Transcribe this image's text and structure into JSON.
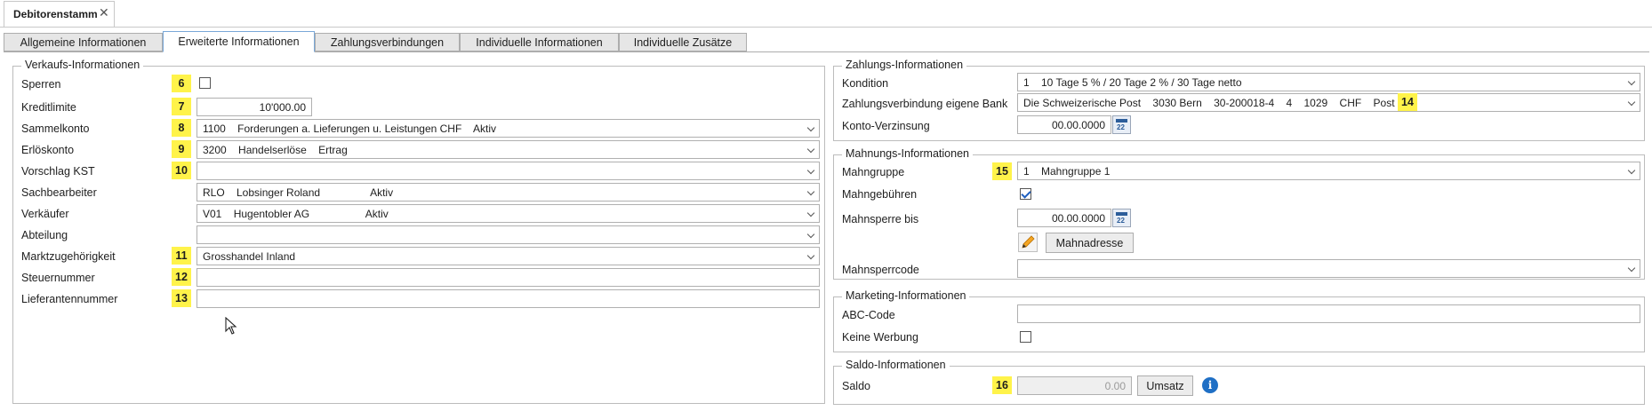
{
  "window": {
    "tab_title": "Debitorenstamm",
    "close_glyph": "✕"
  },
  "tabs": [
    {
      "label": "Allgemeine Informationen"
    },
    {
      "label": "Erweiterte Informationen"
    },
    {
      "label": "Zahlungsverbindungen"
    },
    {
      "label": "Individuelle Informationen"
    },
    {
      "label": "Individuelle Zusätze"
    }
  ],
  "verkauf": {
    "title": "Verkaufs-Informationen",
    "sperren": {
      "label": "Sperren",
      "badge": "6",
      "checked": false
    },
    "kreditlimite": {
      "label": "Kreditlimite",
      "badge": "7",
      "value": "10'000.00"
    },
    "sammelkonto": {
      "label": "Sammelkonto",
      "badge": "8",
      "value": "1100    Forderungen a. Lieferungen u. Leistungen CHF    Aktiv"
    },
    "erloeskonto": {
      "label": "Erlöskonto",
      "badge": "9",
      "value": "3200    Handelserlöse    Ertrag"
    },
    "vorschlag_kst": {
      "label": "Vorschlag KST",
      "badge": "10",
      "value": ""
    },
    "sachbearbeiter": {
      "label": "Sachbearbeiter",
      "value": "RLO    Lobsinger Roland                 Aktiv"
    },
    "verkaeufer": {
      "label": "Verkäufer",
      "value": "V01    Hugentobler AG                   Aktiv"
    },
    "abteilung": {
      "label": "Abteilung",
      "value": ""
    },
    "marktzugehoerigkeit": {
      "label": "Marktzugehörigkeit",
      "badge": "11",
      "value": "Grosshandel Inland"
    },
    "steuernummer": {
      "label": "Steuernummer",
      "badge": "12",
      "value": ""
    },
    "lieferantennummer": {
      "label": "Lieferantennummer",
      "badge": "13",
      "value": ""
    }
  },
  "zahlung": {
    "title": "Zahlungs-Informationen",
    "kondition": {
      "label": "Kondition",
      "value": "1    10 Tage 5 % / 20 Tage 2 % / 30 Tage netto"
    },
    "bank": {
      "label": "Zahlungsverbindung eigene Bank",
      "value": "Die Schweizerische Post    3030 Bern    30-200018-4    4    1029    CHF    Post",
      "badge": "14"
    },
    "konto_verzinsung": {
      "label": "Konto-Verzinsung",
      "value": "00.00.0000"
    }
  },
  "mahnung": {
    "title": "Mahnungs-Informationen",
    "mahngruppe": {
      "label": "Mahngruppe",
      "badge": "15",
      "value": "1    Mahngruppe 1"
    },
    "mahngebuehren": {
      "label": "Mahngebühren",
      "checked": true
    },
    "mahnsperre_bis": {
      "label": "Mahnsperre bis",
      "value": "00.00.0000"
    },
    "mahnadresse_button": "Mahnadresse",
    "mahnsperrcode": {
      "label": "Mahnsperrcode",
      "value": ""
    }
  },
  "marketing": {
    "title": "Marketing-Informationen",
    "abc_code": {
      "label": "ABC-Code",
      "value": ""
    },
    "keine_werbung": {
      "label": "Keine Werbung",
      "checked": false
    }
  },
  "saldo": {
    "title": "Saldo-Informationen",
    "label": "Saldo",
    "badge": "16",
    "value": "0.00",
    "umsatz_button": "Umsatz",
    "info_glyph": "i"
  },
  "calendar_num": "22"
}
